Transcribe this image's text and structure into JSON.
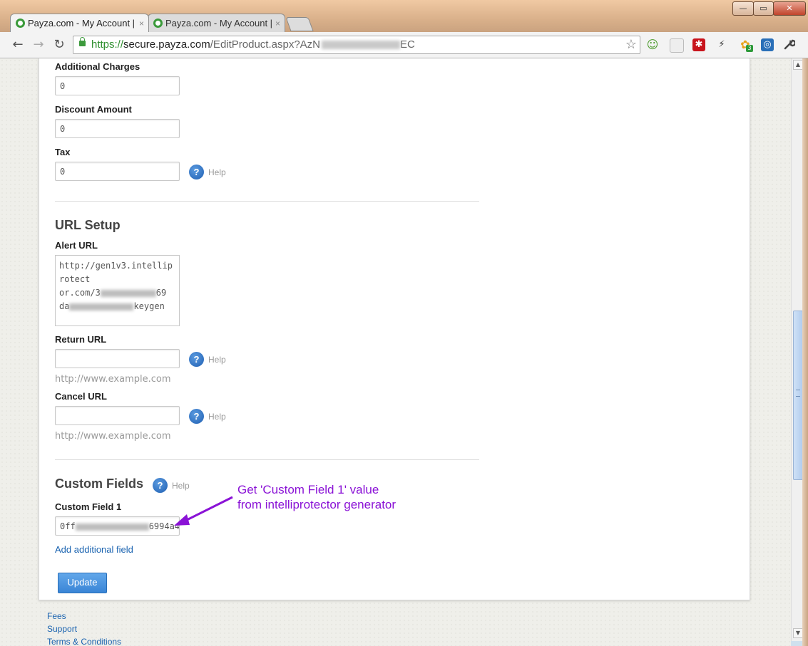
{
  "browser": {
    "tabs": [
      {
        "title": "Payza.com - My Account |"
      },
      {
        "title": "Payza.com - My Account |"
      }
    ],
    "tab_close_glyph": "×",
    "window_controls": {
      "minimize": "—",
      "maximize": "▭",
      "close": "✕"
    },
    "url": {
      "scheme": "https://",
      "host": "secure.payza.com",
      "path": "/EditProduct.aspx?AzN",
      "tail": "EC"
    },
    "nav": {
      "back": "←",
      "forward": "→",
      "reload": "↻"
    },
    "bookmark_glyph": "☆",
    "extensions": [
      {
        "icon": "smiley-icon",
        "glyph": "☺",
        "color": "#4a9a2a"
      },
      {
        "icon": "blank-extension-icon",
        "glyph": "",
        "color": "#eeeeee"
      },
      {
        "icon": "asterisk-extension-icon",
        "glyph": "✱",
        "color": "#c8141c"
      },
      {
        "icon": "bolt-extension-icon",
        "glyph": "⚡",
        "color": "#333333"
      },
      {
        "icon": "flower-extension-icon",
        "glyph": "✿",
        "color": "#e8a21a",
        "badge": "3"
      },
      {
        "icon": "target-extension-icon",
        "glyph": "◎",
        "color": "#2a6fb8"
      },
      {
        "icon": "wrench-icon",
        "glyph": "🔧",
        "color": "#444444"
      }
    ]
  },
  "form": {
    "additional_charges": {
      "label": "Additional Charges",
      "value": "0"
    },
    "discount_amount": {
      "label": "Discount Amount",
      "value": "0"
    },
    "tax": {
      "label": "Tax",
      "value": "0"
    },
    "help_label": "Help",
    "help_glyph": "?",
    "url_setup": {
      "title": "URL Setup",
      "alert_url": {
        "label": "Alert URL",
        "line1": "http://gen1v3.intelliprotect",
        "line2_start": "or.com/3",
        "line2_end": "69",
        "line3_start": "da",
        "line3_end": "keygen"
      },
      "return_url": {
        "label": "Return URL",
        "value": "",
        "hint": "http://www.example.com"
      },
      "cancel_url": {
        "label": "Cancel URL",
        "value": "",
        "hint": "http://www.example.com"
      }
    },
    "custom_fields": {
      "title": "Custom Fields",
      "field1": {
        "label": "Custom Field 1",
        "value_start": "0ff",
        "value_end": "6994a4"
      },
      "add_link": "Add additional field"
    },
    "update_button": "Update"
  },
  "annotation": {
    "line1": "Get 'Custom Field 1' value",
    "line2": "from intelliprotector generator",
    "color": "#8a12d6"
  },
  "footer_links": [
    "Fees",
    "Support",
    "Terms & Conditions"
  ]
}
